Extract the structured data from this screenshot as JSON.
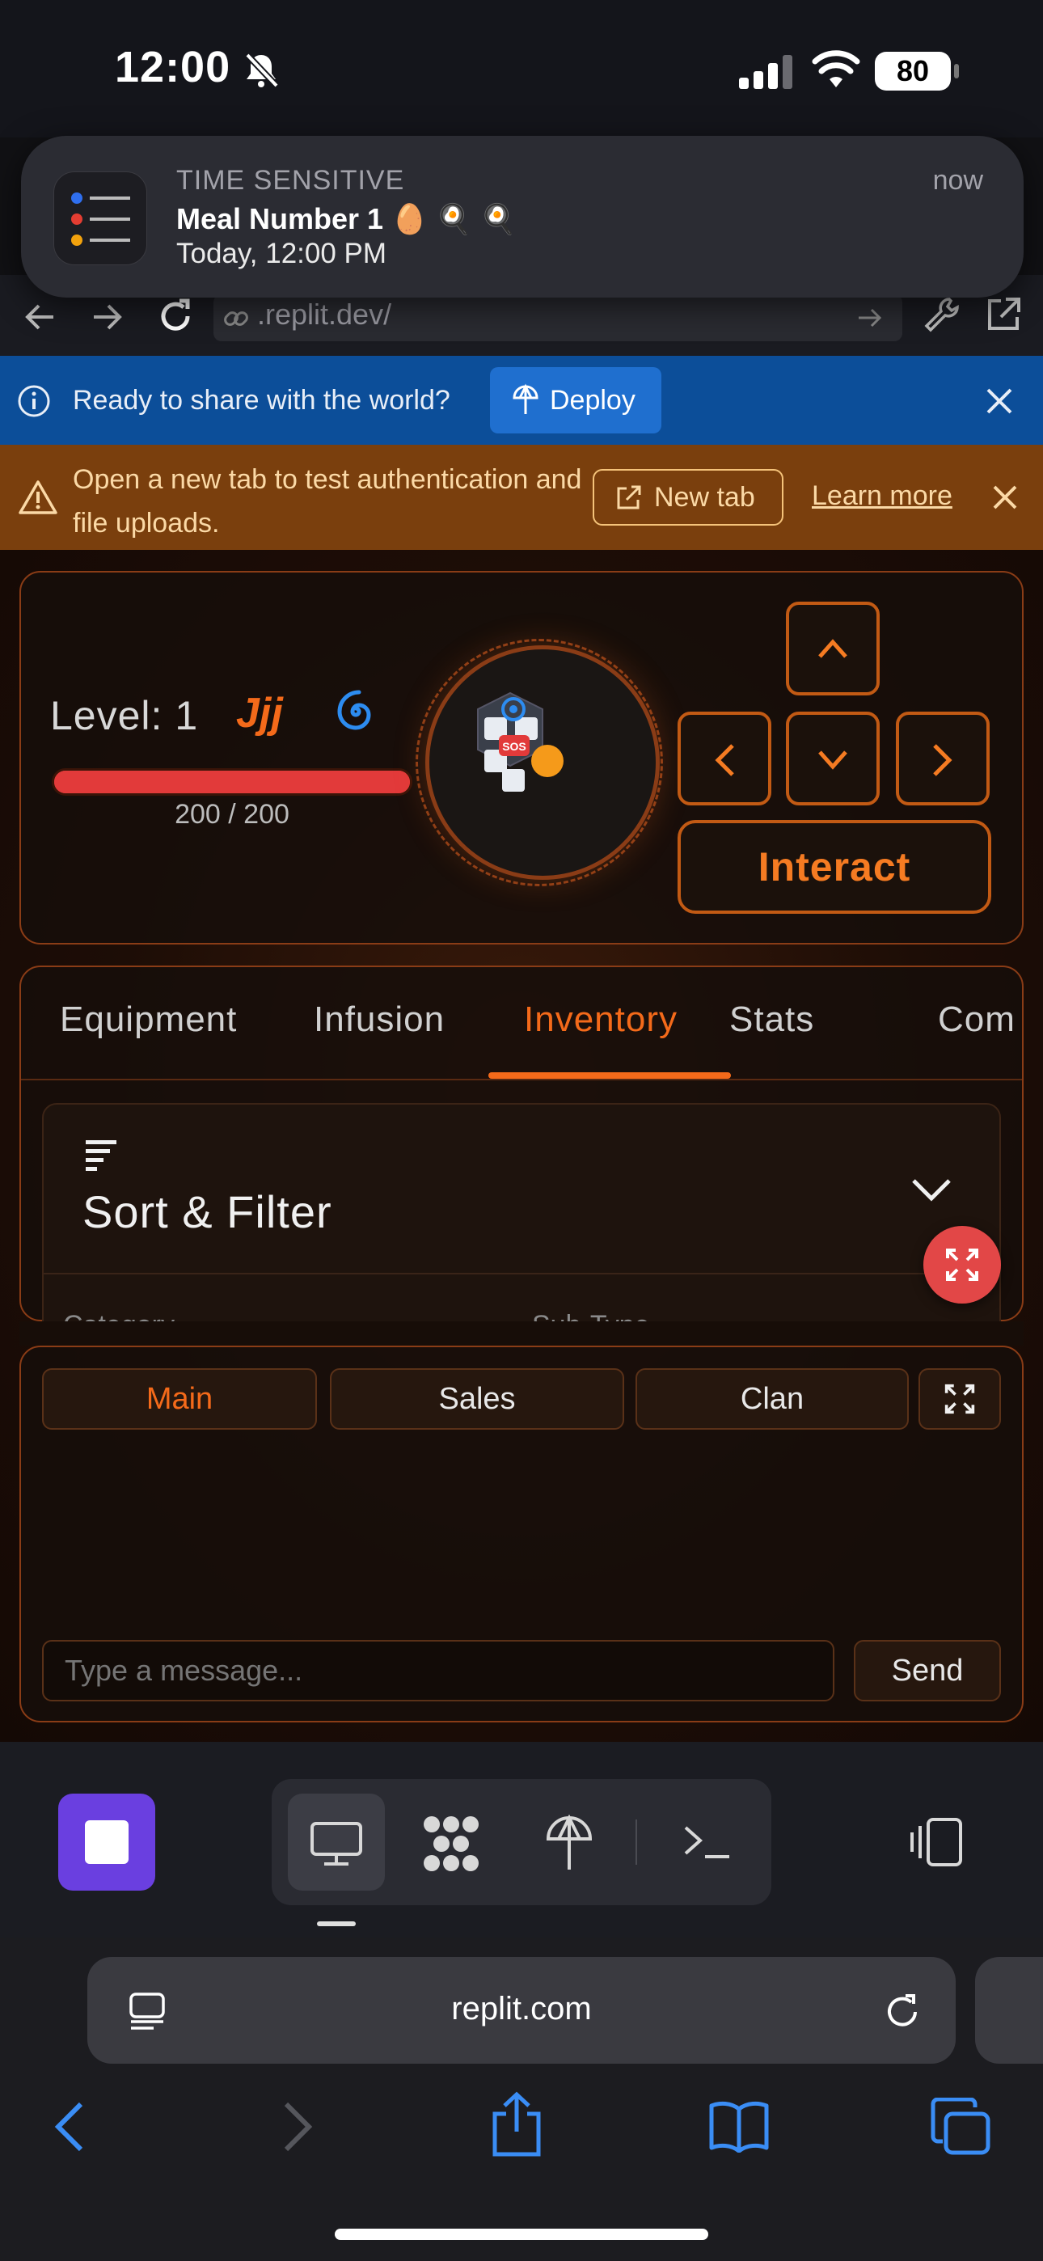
{
  "status_bar": {
    "time": "12:00",
    "battery": "80"
  },
  "notification": {
    "tag": "TIME SENSITIVE",
    "title": "Meal Number 1 🥚 🍳 🍳",
    "subtitle": "Today, 12:00 PM",
    "age": "now"
  },
  "browser_toolbar": {
    "url": ".replit.dev/"
  },
  "deploy_banner": {
    "message": "Ready to share with the world?",
    "button": "Deploy"
  },
  "warning_banner": {
    "message": "Open a new tab to test authentication and file uploads.",
    "new_tab": "New tab",
    "learn_more": "Learn more"
  },
  "player": {
    "level_label": "Level: 1",
    "clan_tag": "Jjj",
    "hp": "200 / 200",
    "hp_fraction": 1.0,
    "emblem_badge": "SOS"
  },
  "controls": {
    "interact": "Interact"
  },
  "tabs": [
    {
      "label": "Equipment",
      "active": false
    },
    {
      "label": "Infusion",
      "active": false
    },
    {
      "label": "Inventory",
      "active": true
    },
    {
      "label": "Stats",
      "active": false
    },
    {
      "label": "Com",
      "active": false
    }
  ],
  "sort_filter": {
    "title": "Sort & Filter",
    "category_label": "Category",
    "subtype_label": "Sub-Type"
  },
  "chat": {
    "tabs": [
      {
        "label": "Main",
        "active": true
      },
      {
        "label": "Sales",
        "active": false
      },
      {
        "label": "Clan",
        "active": false
      }
    ],
    "placeholder": "Type a message...",
    "send": "Send"
  },
  "safari": {
    "domain": "replit.com"
  },
  "colors": {
    "accent": "#f46a1a",
    "deploy_bar": "#0c4e99",
    "warning_bar": "#7a3f0d",
    "hp": "#e23a3a",
    "stop": "#6a3fe0"
  }
}
